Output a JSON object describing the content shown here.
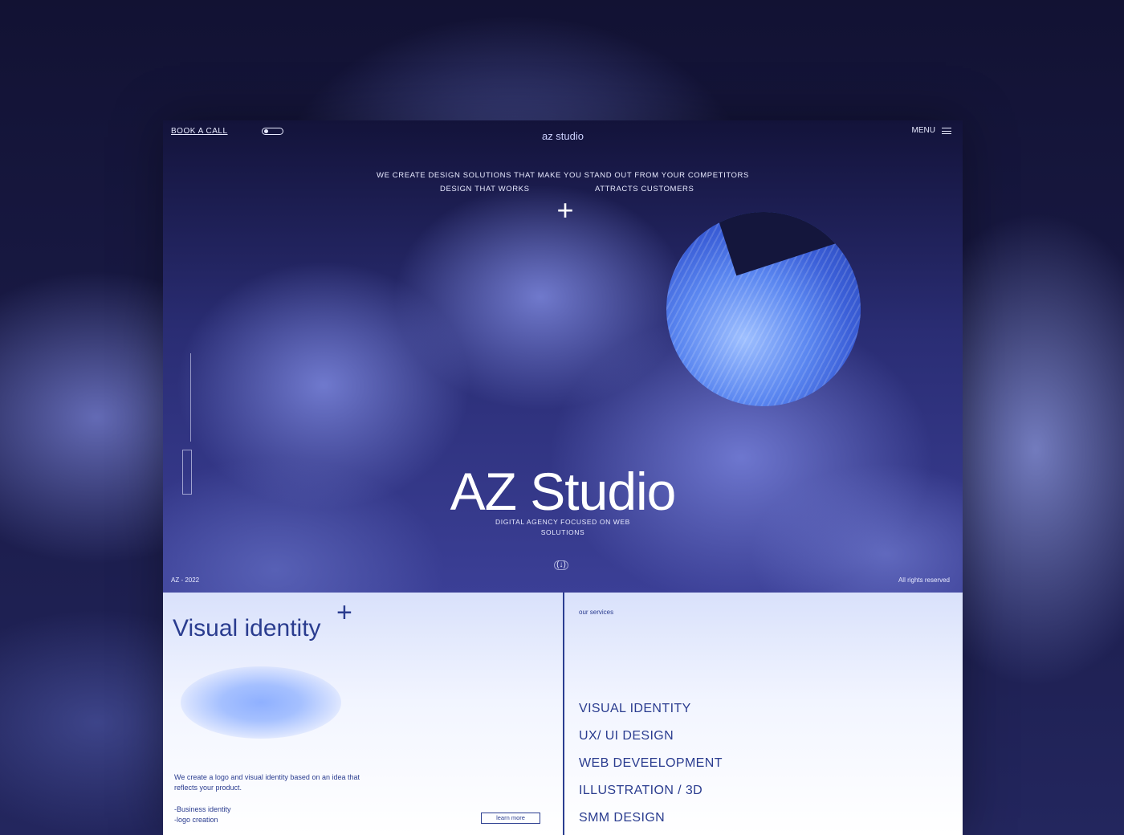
{
  "header": {
    "book_call": "BOOK A CALL",
    "brand": "az studio",
    "menu": "MENU"
  },
  "hero": {
    "tagline_line1": "WE CREATE DESIGN SOLUTIONS THAT MAKE YOU STAND OUT FROM YOUR COMPETITORS",
    "tagline_line2_left": "DESIGN THAT WORKS",
    "tagline_line2_right": "ATTRACTS CUSTOMERS",
    "plus": "+",
    "title": "AZ Studio",
    "subtitle": "DIGITAL AGENCY FOCUSED ON WEB SOLUTIONS",
    "scroll_indicator": "(↓)",
    "footer_left": "AZ - 2022",
    "footer_right": "All rights reserved"
  },
  "visual_identity": {
    "title": "Visual identity",
    "plus": "+",
    "description": "We create a logo and visual identity based on an idea that reflects your product.",
    "list": [
      "-Business identity",
      "-logo creation"
    ],
    "button": "learn more"
  },
  "services": {
    "label": "our services",
    "items": [
      "VISUAL IDENTITY",
      "UX/ UI DESIGN",
      "WEB DEVEELOPMENT",
      "ILLUSTRATION / 3D",
      "SMM DESIGN"
    ]
  },
  "colors": {
    "accent": "#2a3c8f",
    "hero_dark": "#13133a",
    "blob": "#8fb0ff"
  }
}
